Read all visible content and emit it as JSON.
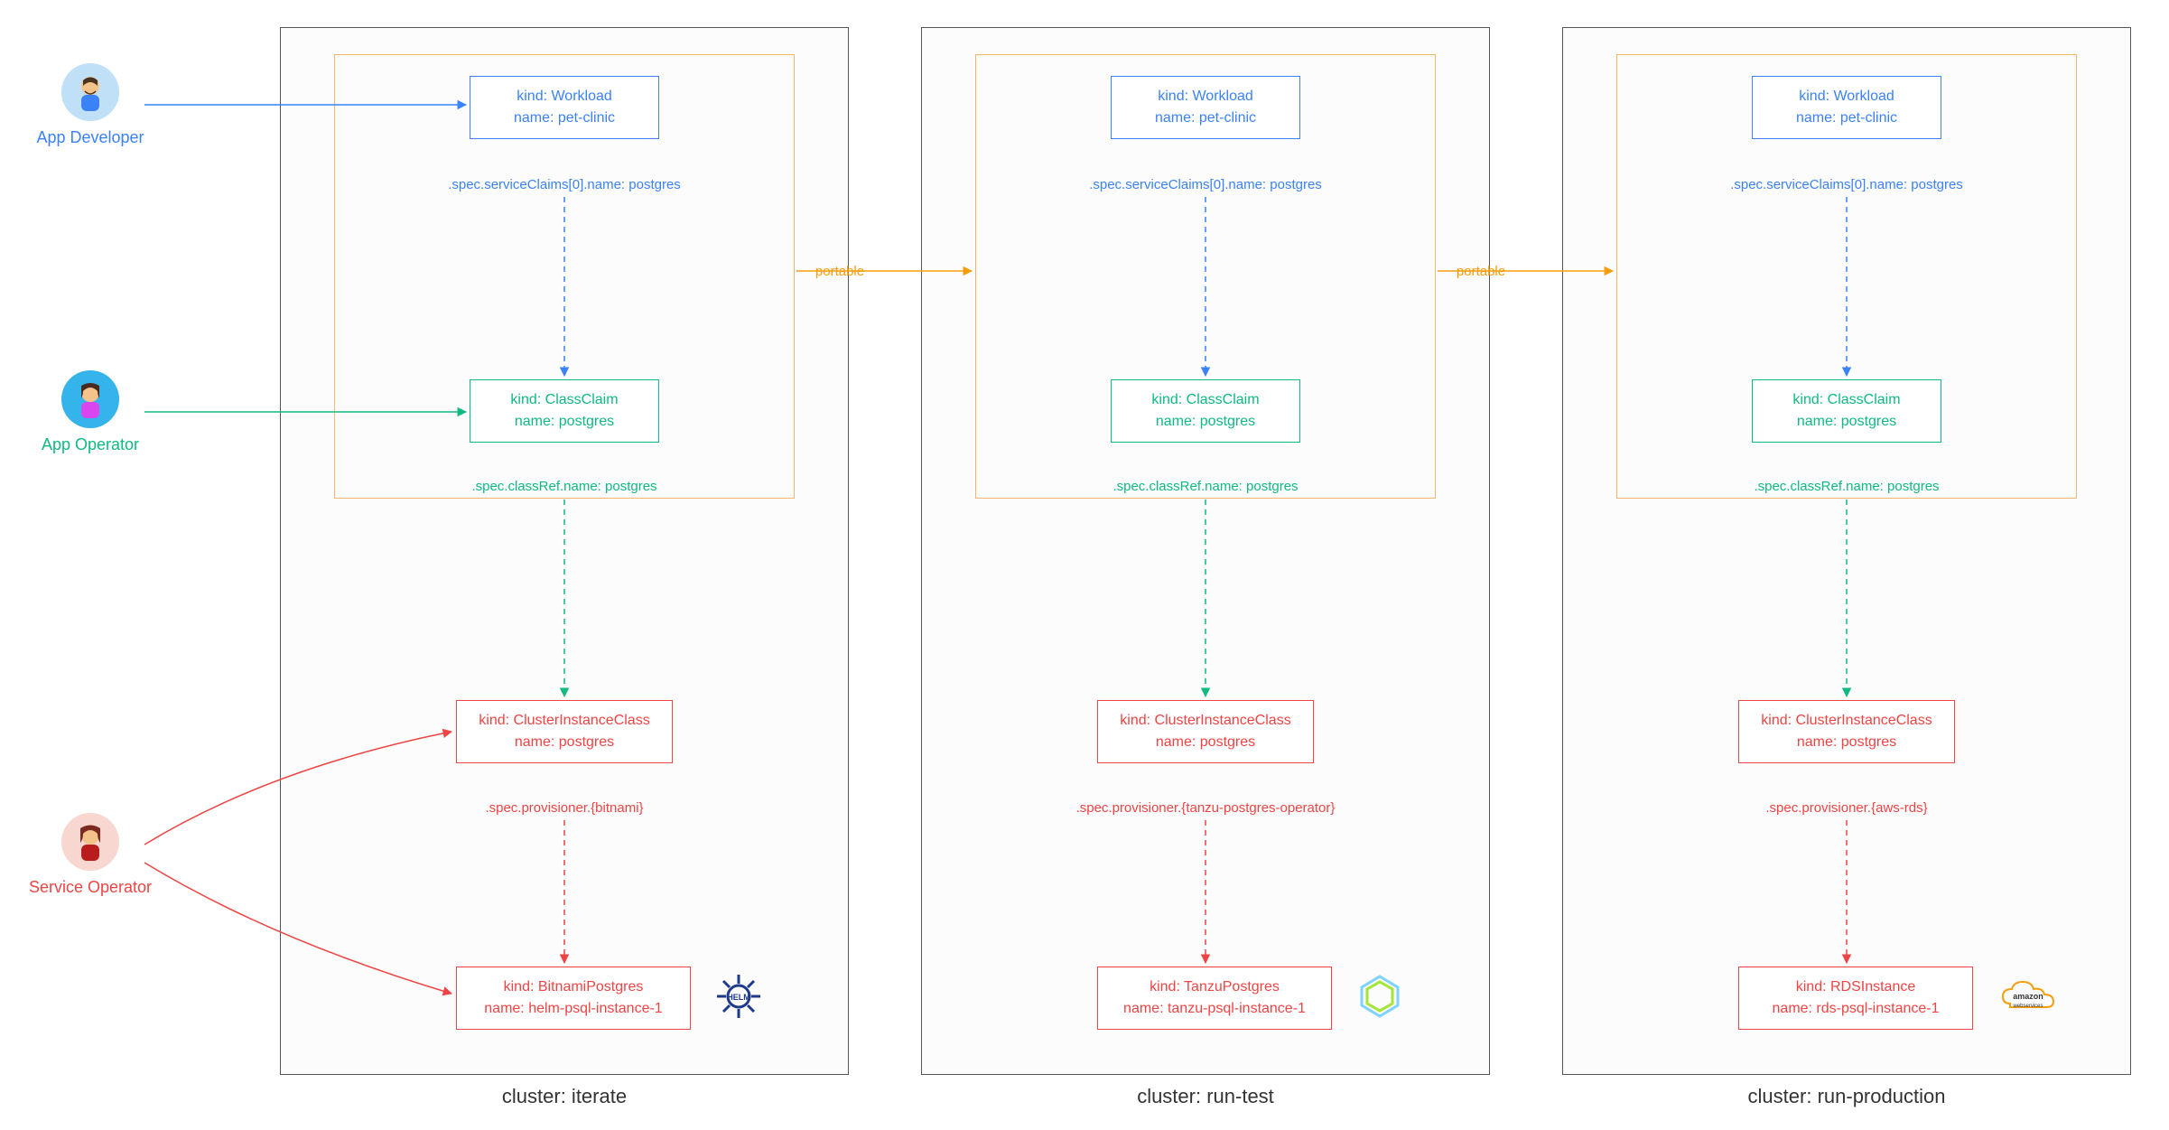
{
  "personas": {
    "appDeveloper": "App Developer",
    "appOperator": "App Operator",
    "serviceOperator": "Service Operator"
  },
  "portableLabel": "portable",
  "clusters": [
    {
      "label": "cluster: iterate",
      "workload_kind": "kind: Workload",
      "workload_name": "name: pet-clinic",
      "workload_spec": ".spec.serviceClaims[0].name: postgres",
      "classclaim_kind": "kind: ClassClaim",
      "classclaim_name": "name: postgres",
      "classclaim_spec": ".spec.classRef.name: postgres",
      "class_kind": "kind: ClusterInstanceClass",
      "class_name": "name: postgres",
      "provisioner": ".spec.provisioner.{bitnami}",
      "instance_kind": "kind: BitnamiPostgres",
      "instance_name": "name: helm-psql-instance-1",
      "icon": "helm"
    },
    {
      "label": "cluster: run-test",
      "workload_kind": "kind: Workload",
      "workload_name": "name: pet-clinic",
      "workload_spec": ".spec.serviceClaims[0].name: postgres",
      "classclaim_kind": "kind: ClassClaim",
      "classclaim_name": "name: postgres",
      "classclaim_spec": ".spec.classRef.name: postgres",
      "class_kind": "kind: ClusterInstanceClass",
      "class_name": "name: postgres",
      "provisioner": ".spec.provisioner.{tanzu-postgres-operator}",
      "instance_kind": "kind: TanzuPostgres",
      "instance_name": "name: tanzu-psql-instance-1",
      "icon": "tanzu"
    },
    {
      "label": "cluster: run-production",
      "workload_kind": "kind: Workload",
      "workload_name": "name: pet-clinic",
      "workload_spec": ".spec.serviceClaims[0].name: postgres",
      "classclaim_kind": "kind: ClassClaim",
      "classclaim_name": "name: postgres",
      "classclaim_spec": ".spec.classRef.name: postgres",
      "class_kind": "kind: ClusterInstanceClass",
      "class_name": "name: postgres",
      "provisioner": ".spec.provisioner.{aws-rds}",
      "instance_kind": "kind: RDSInstance",
      "instance_name": "name: rds-psql-instance-1",
      "icon": "aws"
    }
  ],
  "colors": {
    "blue": "#3b82f6",
    "green": "#10b981",
    "red": "#ef4444",
    "orange": "#f59e0b",
    "border": "#555555"
  }
}
